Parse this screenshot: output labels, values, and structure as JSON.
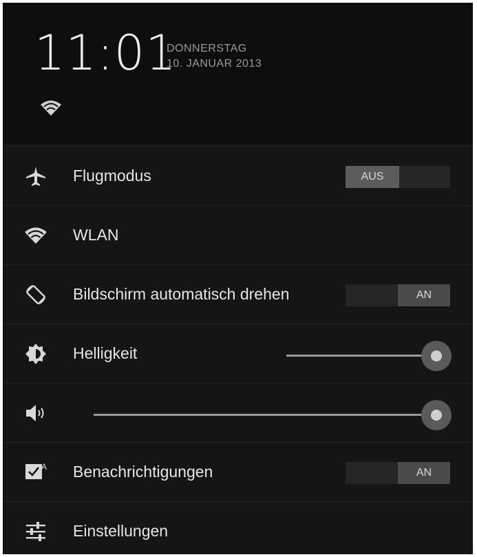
{
  "status": {
    "time": "11:01",
    "day": "DONNERSTAG",
    "date": "10. JANUAR 2013",
    "wifi_icon": "wifi-icon"
  },
  "settings": {
    "airplane": {
      "label": "Flugmodus",
      "icon": "airplane-icon",
      "toggle_text": "AUS",
      "state": "off"
    },
    "wlan": {
      "label": "WLAN",
      "icon": "wifi-icon"
    },
    "rotation": {
      "label": "Bildschirm automatisch drehen",
      "icon": "rotate-icon",
      "toggle_text": "AN",
      "state": "on"
    },
    "brightness": {
      "label": "Helligkeit",
      "icon": "brightness-icon",
      "level": 1.0
    },
    "volume": {
      "icon": "volume-icon",
      "level": 1.0
    },
    "notifications": {
      "label": "Benachrichtigungen",
      "icon": "notifications-icon",
      "toggle_text": "AN",
      "state": "on"
    },
    "settings": {
      "label": "Einstellungen",
      "icon": "settings-sliders-icon"
    }
  },
  "colors": {
    "background": "#151515",
    "header_background": "#0e0e0e",
    "text": "#e6e6e6",
    "secondary_text": "#9a9a9a"
  }
}
